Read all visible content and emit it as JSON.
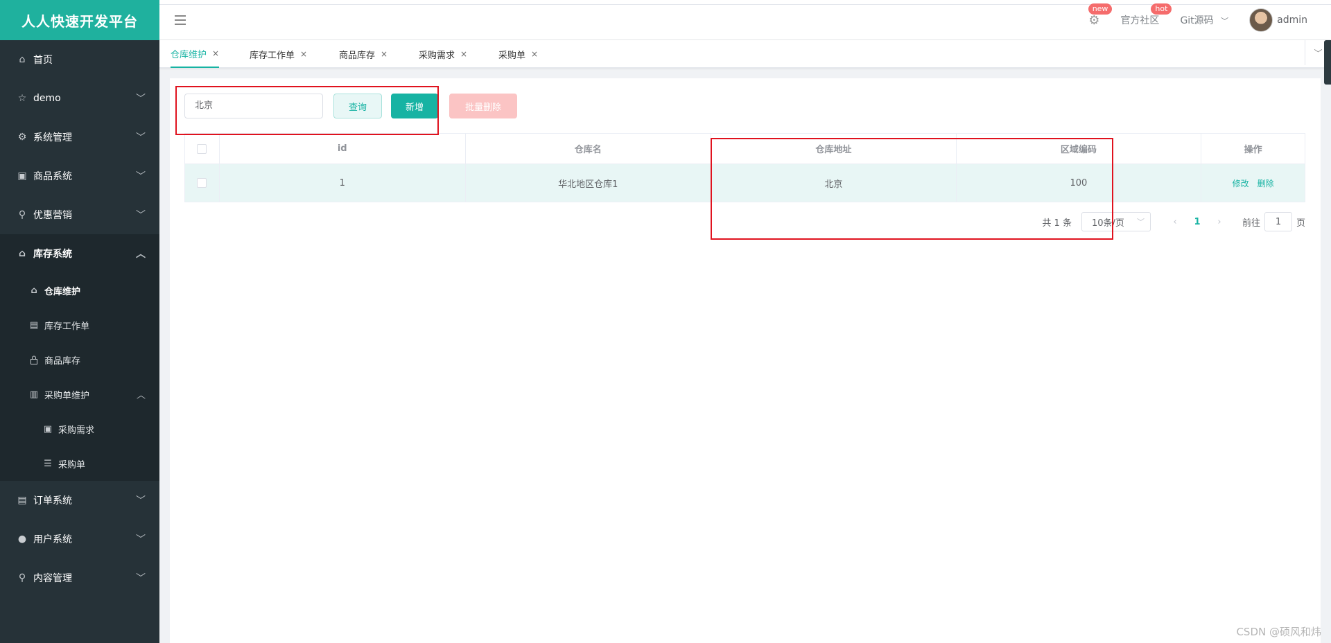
{
  "app": {
    "brand": "人人快速开发平台"
  },
  "sidebar": {
    "items": [
      {
        "label": "首页",
        "icon": "home-icon",
        "glyph": "⌂",
        "arrow": ""
      },
      {
        "label": "demo",
        "icon": "star-icon",
        "glyph": "☆",
        "arrow": "﹀"
      },
      {
        "label": "系统管理",
        "icon": "gear-icon",
        "glyph": "⚙",
        "arrow": "﹀"
      },
      {
        "label": "商品系统",
        "icon": "grid-icon",
        "glyph": "▣",
        "arrow": "﹀"
      },
      {
        "label": "优惠营销",
        "icon": "coupon-icon",
        "glyph": "⚲",
        "arrow": "﹀"
      },
      {
        "label": "库存系统",
        "icon": "home-icon",
        "glyph": "⌂",
        "arrow": "︿"
      }
    ],
    "stock_sub": [
      {
        "label": "仓库维护",
        "icon": "home-icon",
        "glyph": "⌂"
      },
      {
        "label": "库存工作单",
        "icon": "document-icon",
        "glyph": "▤"
      },
      {
        "label": "商品库存",
        "icon": "lock-icon",
        "glyph": "🔒"
      },
      {
        "label": "采购单维护",
        "icon": "bar-chart-icon",
        "glyph": "▥",
        "arrow": "︿"
      }
    ],
    "purchase_sub": [
      {
        "label": "采购需求",
        "icon": "grid-icon",
        "glyph": "▣"
      },
      {
        "label": "采购单",
        "icon": "list-icon",
        "glyph": "☰"
      }
    ],
    "bottom_items": [
      {
        "label": "订单系统",
        "icon": "order-icon",
        "glyph": "▤",
        "arrow": "﹀"
      },
      {
        "label": "用户系统",
        "icon": "user-icon",
        "glyph": "●",
        "arrow": "﹀"
      },
      {
        "label": "内容管理",
        "icon": "search-icon",
        "glyph": "⚲",
        "arrow": "﹀"
      }
    ]
  },
  "header": {
    "gear_badge": "new",
    "community_label": "官方社区",
    "community_badge": "hot",
    "git_label": "Git源码",
    "user_name": "admin"
  },
  "tabs": [
    {
      "label": "仓库维护",
      "close": "×"
    },
    {
      "label": "库存工作单",
      "close": "×"
    },
    {
      "label": "商品库存",
      "close": "×"
    },
    {
      "label": "采购需求",
      "close": "×"
    },
    {
      "label": "采购单",
      "close": "×"
    }
  ],
  "toolbar": {
    "search_value": "北京",
    "query_label": "查询",
    "add_label": "新增",
    "batch_delete_label": "批量删除"
  },
  "table": {
    "columns": [
      "id",
      "仓库名",
      "仓库地址",
      "区域编码",
      "操作"
    ],
    "rows": [
      {
        "id": "1",
        "name": "华北地区仓库1",
        "address": "北京",
        "areacode": "100",
        "edit": "修改",
        "delete": "删除"
      }
    ]
  },
  "pagination": {
    "total": "共 1 条",
    "page_size": "10条/页",
    "current": "1",
    "goto_prefix": "前往",
    "goto_value": "1",
    "goto_suffix": "页"
  },
  "watermark": "CSDN @硕风和炜",
  "colors": {
    "brand": "#1fb19e",
    "accent": "#17b3a3",
    "sidebar": "#263238",
    "annotation": "#e0121e"
  }
}
